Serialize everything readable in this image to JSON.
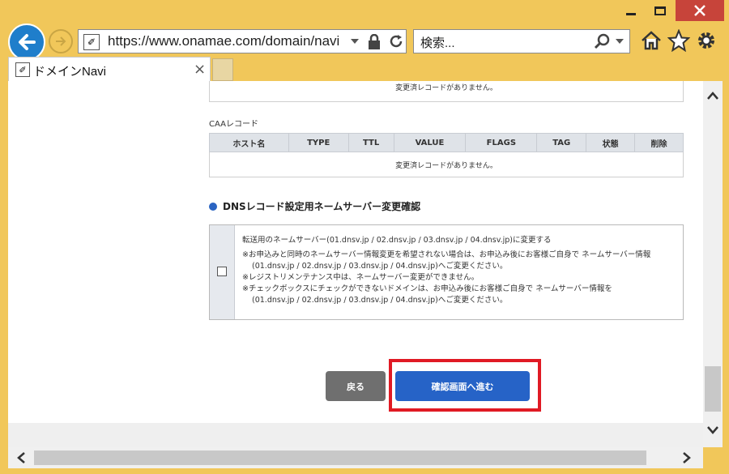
{
  "browser": {
    "address_url": "https://www.onamae.com/domain/navi",
    "search_placeholder": "検索...",
    "tab_title": "ドメインNavi",
    "tab_close": "×"
  },
  "page": {
    "empty_message_top": "変更済レコードがありません。",
    "caa": {
      "label": "CAAレコード",
      "columns": [
        "ホスト名",
        "TYPE",
        "TTL",
        "VALUE",
        "FLAGS",
        "TAG",
        "状態",
        "削除"
      ],
      "empty_message": "変更済レコードがありません。"
    },
    "section_title": "DNSレコード設定用ネームサーバー変更確認",
    "nameserver_option": {
      "checked": false,
      "lines": [
        "転送用のネームサーバー(01.dnsv.jp / 02.dnsv.jp / 03.dnsv.jp / 04.dnsv.jp)に変更する",
        "※お申込みと同時のネームサーバー情報変更を希望されない場合は、お申込み後にお客様ご自身で ネームサーバー情報",
        "(01.dnsv.jp / 02.dnsv.jp / 03.dnsv.jp / 04.dnsv.jp)へご変更ください。",
        "※レジストリメンテナンス中は、ネームサーバー変更ができません。",
        "※チェックボックスにチェックができないドメインは、お申込み後にお客様ご自身で ネームサーバー情報を",
        "(01.dnsv.jp / 02.dnsv.jp / 03.dnsv.jp / 04.dnsv.jp)へご変更ください。"
      ]
    },
    "back_button": "戻る",
    "confirm_button": "確認画面へ進む"
  },
  "colors": {
    "frame": "#f1c75a",
    "accent_blue": "#2663c7",
    "highlight_red": "#e01a24",
    "close_red": "#c7443a"
  }
}
